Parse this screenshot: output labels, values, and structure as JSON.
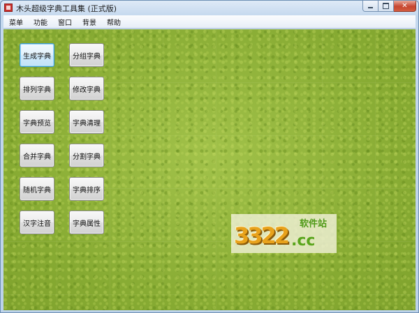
{
  "window": {
    "title": "木头超级字典工具集 (正式版)",
    "controls": {
      "minimize_icon": "minimize-icon",
      "maximize_icon": "maximize-icon",
      "close_icon": "close-icon",
      "close_glyph": "✕"
    }
  },
  "menubar": {
    "items": [
      "菜单",
      "功能",
      "窗口",
      "背景",
      "帮助"
    ]
  },
  "buttons": {
    "left": [
      "生成字典",
      "排列字典",
      "字典预览",
      "合并字典",
      "随机字典",
      "汉字注音"
    ],
    "right": [
      "分组字典",
      "修改字典",
      "字典清理",
      "分割字典",
      "字典排序",
      "字典属性"
    ],
    "focused": "生成字典"
  },
  "watermark": {
    "digits": "3322",
    "domain": ".cc",
    "tag": "软件站"
  },
  "colors": {
    "grass": "#8fb43a",
    "close_button": "#c6452f",
    "focus_border": "#3c9bd6",
    "watermark_orange": "#e8a21b",
    "watermark_green": "#5aa51c"
  }
}
